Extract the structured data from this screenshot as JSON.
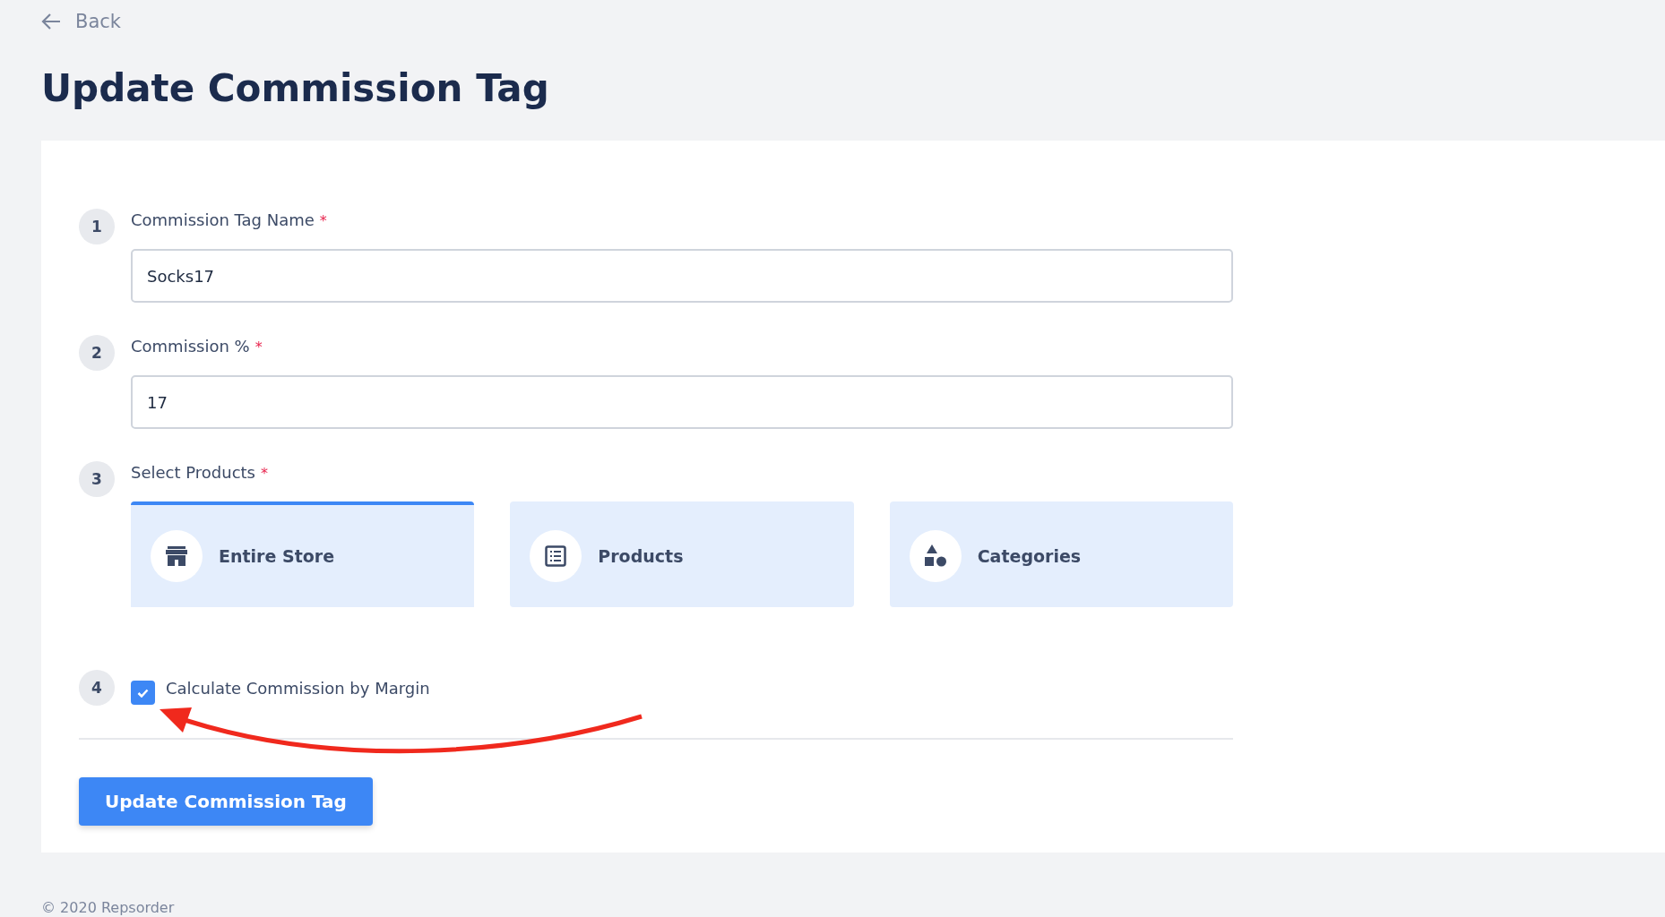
{
  "back": {
    "label": "Back"
  },
  "title": "Update Commission Tag",
  "steps": [
    {
      "number": "1",
      "kind": "input",
      "label": "Commission Tag Name",
      "required_mark": "*",
      "value": "Socks17"
    },
    {
      "number": "2",
      "kind": "input",
      "label": "Commission %",
      "required_mark": "*",
      "value": "17"
    },
    {
      "number": "3",
      "kind": "options",
      "label": "Select Products",
      "required_mark": "*",
      "options": [
        {
          "label": "Entire Store",
          "selected": true
        },
        {
          "label": "Products",
          "selected": false
        },
        {
          "label": "Categories",
          "selected": false
        }
      ]
    },
    {
      "number": "4",
      "kind": "checkbox",
      "label": "Calculate Commission by Margin",
      "checked": true
    }
  ],
  "submit": "Update Commission Tag",
  "footer": "© 2020 Repsorder"
}
